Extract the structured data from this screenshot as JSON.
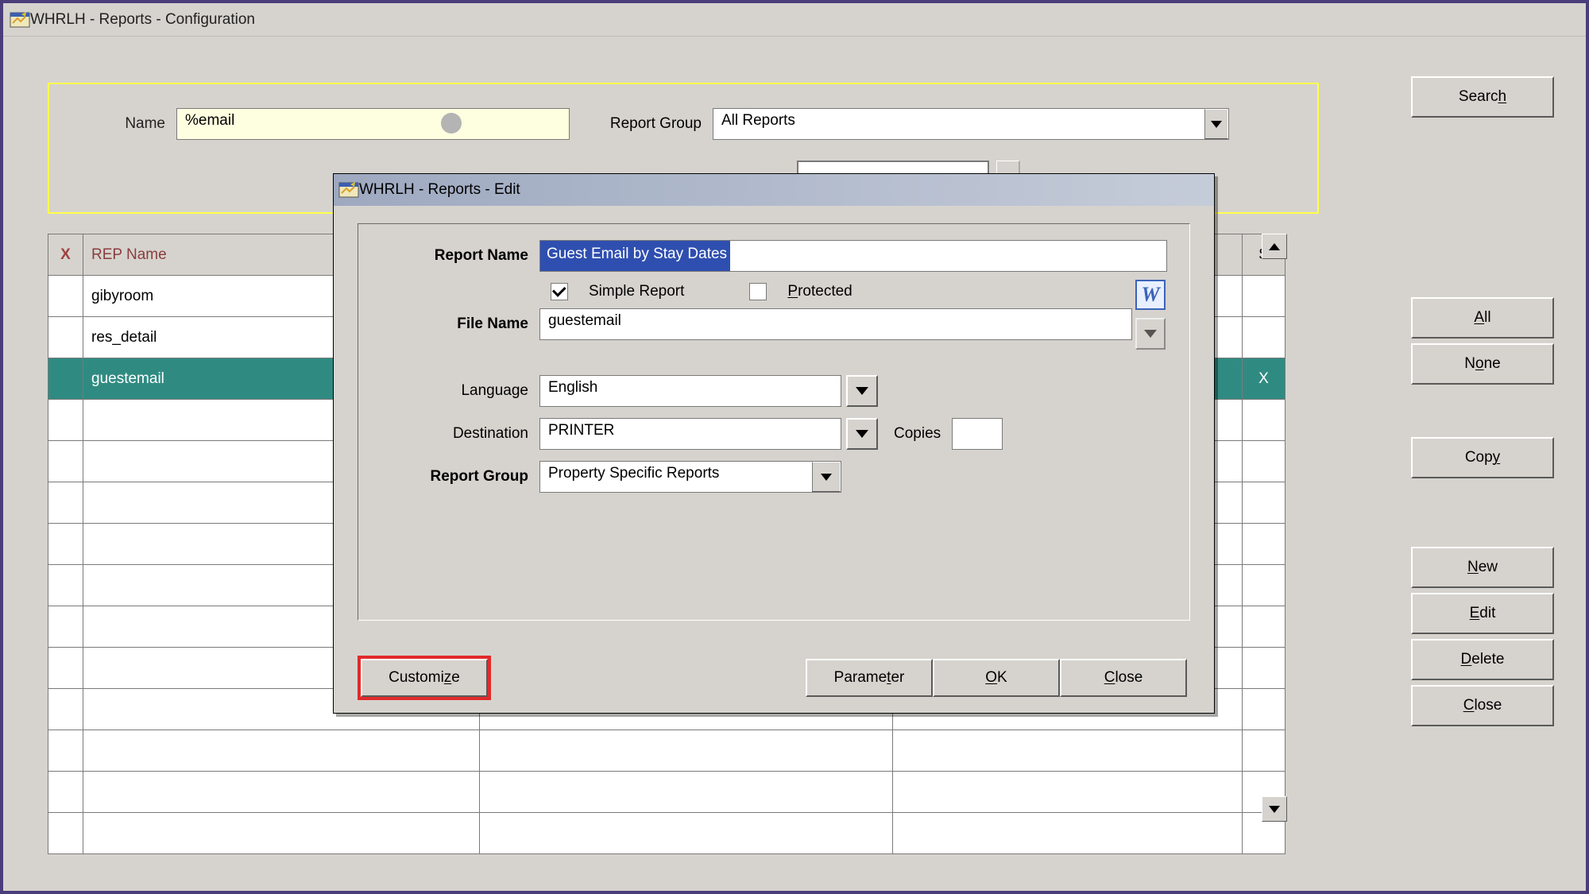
{
  "main": {
    "title": "WHRLH - Reports - Configuration"
  },
  "filter": {
    "name_label": "Name",
    "name_value": "%email",
    "group_label": "Report Group",
    "group_value": "All Reports",
    "secondary_partial": ""
  },
  "table": {
    "headers": {
      "x": "X",
      "name": "REP Name",
      "s": "S"
    },
    "rows": [
      {
        "name": "gibyroom",
        "s": "",
        "selected": false
      },
      {
        "name": "res_detail",
        "s": "",
        "selected": false
      },
      {
        "name": "guestemail",
        "s": "X",
        "selected": true
      },
      {
        "name": "",
        "s": "",
        "selected": false
      },
      {
        "name": "",
        "s": "",
        "selected": false
      },
      {
        "name": "",
        "s": "",
        "selected": false
      },
      {
        "name": "",
        "s": "",
        "selected": false
      },
      {
        "name": "",
        "s": "",
        "selected": false
      },
      {
        "name": "",
        "s": "",
        "selected": false
      },
      {
        "name": "",
        "s": "",
        "selected": false
      },
      {
        "name": "",
        "s": "",
        "selected": false
      },
      {
        "name": "",
        "s": "",
        "selected": false
      },
      {
        "name": "",
        "s": "",
        "selected": false
      },
      {
        "name": "",
        "s": "",
        "selected": false
      }
    ]
  },
  "buttons": {
    "search": "Search",
    "all": "All",
    "none": "None",
    "copy": "Copy",
    "new": "New",
    "edit": "Edit",
    "delete": "Delete",
    "close": "Close"
  },
  "dialog": {
    "title": "WHRLH - Reports - Edit",
    "fields": {
      "report_name_label": "Report Name",
      "report_name_value": "Guest Email by Stay Dates",
      "simple_report_label": "Simple Report",
      "simple_report_checked": true,
      "protected_label": "Protected",
      "protected_checked": false,
      "word_checked": false,
      "file_name_label": "File Name",
      "file_name_value": "guestemail",
      "language_label": "Language",
      "language_value": "English",
      "destination_label": "Destination",
      "destination_value": "PRINTER",
      "copies_label": "Copies",
      "copies_value": "",
      "report_group_label": "Report Group",
      "report_group_value": "Property Specific Reports"
    },
    "buttons": {
      "customize": "Customize",
      "parameter": "Parameter",
      "ok": "OK",
      "close": "Close"
    }
  },
  "icons": {
    "word": "W"
  }
}
